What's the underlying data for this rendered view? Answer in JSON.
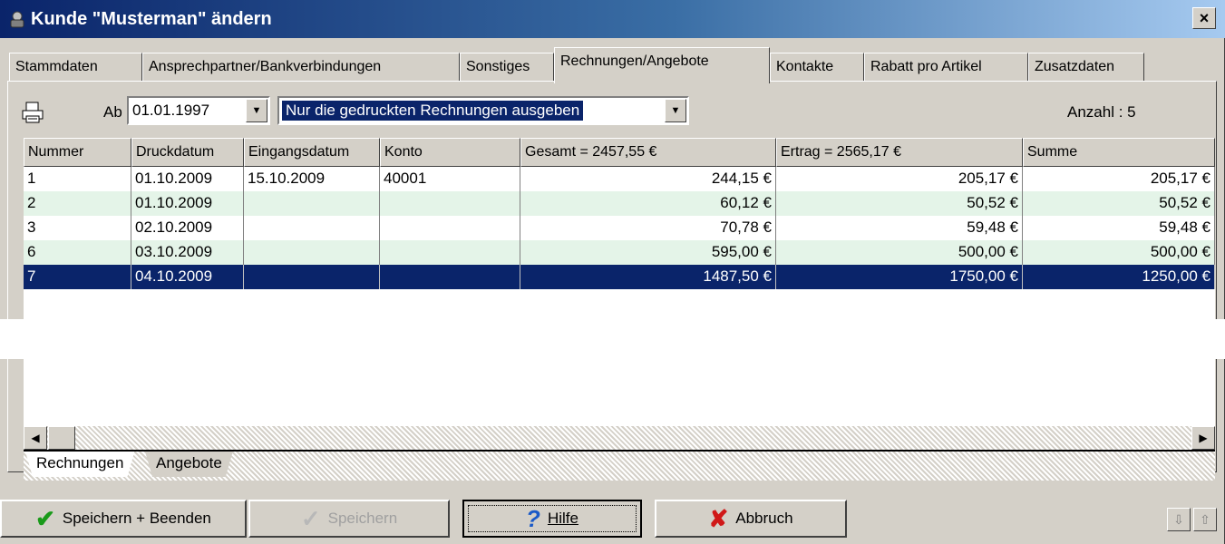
{
  "window": {
    "title": "Kunde \"Musterman\" ändern",
    "close_glyph": "×"
  },
  "tabs": [
    {
      "label": "Stammdaten"
    },
    {
      "label": "Ansprechpartner/Bankverbindungen"
    },
    {
      "label": "Sonstiges"
    },
    {
      "label": "Rechnungen/Angebote",
      "active": true
    },
    {
      "label": "Kontakte"
    },
    {
      "label": "Rabatt pro Artikel"
    },
    {
      "label": "Zusatzdaten"
    }
  ],
  "toolbar": {
    "printer_icon": "printer-icon",
    "ab_label": "Ab",
    "date_value": "01.01.1997",
    "filter_value": "Nur die gedruckten Rechnungen ausgeben",
    "anzahl_label": "Anzahl :",
    "anzahl_value": "5"
  },
  "grid": {
    "columns": [
      "Nummer",
      "Druckdatum",
      "Eingangsdatum",
      "Konto",
      "Gesamt = 2457,55 €",
      "Ertrag = 2565,17 €",
      "Summe"
    ],
    "rows": [
      [
        "1",
        "01.10.2009",
        "15.10.2009",
        "40001",
        "244,15 €",
        "205,17 €",
        "205,17 €"
      ],
      [
        "2",
        "01.10.2009",
        "",
        "",
        "60,12 €",
        "50,52 €",
        "50,52 €"
      ],
      [
        "3",
        "02.10.2009",
        "",
        "",
        "70,78 €",
        "59,48 €",
        "59,48 €"
      ],
      [
        "6",
        "03.10.2009",
        "",
        "",
        "595,00 €",
        "500,00 €",
        "500,00 €"
      ],
      [
        "7",
        "04.10.2009",
        "",
        "",
        "1487,50 €",
        "1750,00 €",
        "1250,00 €"
      ]
    ],
    "selected_row": 4
  },
  "subtabs": [
    {
      "label": "Rechnungen",
      "active": true
    },
    {
      "label": "Angebote",
      "active": false
    }
  ],
  "buttons": {
    "save_close": "Speichern + Beenden",
    "save": "Speichern",
    "help": "Hilfe",
    "cancel": "Abbruch"
  },
  "colors": {
    "selection": "#0a246a",
    "alt_row": "#e4f4e8",
    "face": "#d4d0c8"
  }
}
